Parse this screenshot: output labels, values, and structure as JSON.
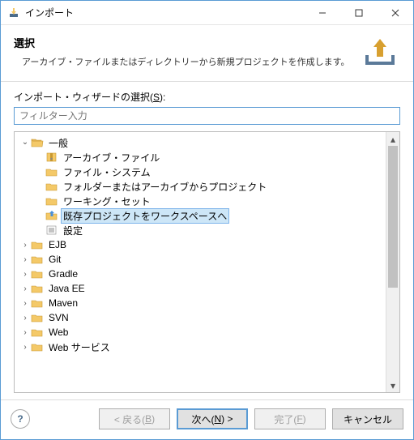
{
  "window": {
    "title": "インポート"
  },
  "banner": {
    "title": "選択",
    "description": "アーカイブ・ファイルまたはディレクトリーから新規プロジェクトを作成します。"
  },
  "form": {
    "select_label_prefix": "インポート・ウィザードの選択(",
    "select_mnemonic": "S",
    "select_label_suffix": "):",
    "filter_placeholder": "フィルター入力"
  },
  "tree": [
    {
      "label": "一般",
      "depth": 0,
      "expandable": true,
      "expanded": true,
      "icon": "folder-open",
      "selected": false
    },
    {
      "label": "アーカイブ・ファイル",
      "depth": 1,
      "expandable": false,
      "icon": "archive",
      "selected": false
    },
    {
      "label": "ファイル・システム",
      "depth": 1,
      "expandable": false,
      "icon": "folder",
      "selected": false
    },
    {
      "label": "フォルダーまたはアーカイブからプロジェクト",
      "depth": 1,
      "expandable": false,
      "icon": "folder",
      "selected": false
    },
    {
      "label": "ワーキング・セット",
      "depth": 1,
      "expandable": false,
      "icon": "folder",
      "selected": false
    },
    {
      "label": "既存プロジェクトをワークスペースへ",
      "depth": 1,
      "expandable": false,
      "icon": "import",
      "selected": true
    },
    {
      "label": "設定",
      "depth": 1,
      "expandable": false,
      "icon": "prefs",
      "selected": false
    },
    {
      "label": "EJB",
      "depth": 0,
      "expandable": true,
      "expanded": false,
      "icon": "folder",
      "selected": false
    },
    {
      "label": "Git",
      "depth": 0,
      "expandable": true,
      "expanded": false,
      "icon": "folder",
      "selected": false
    },
    {
      "label": "Gradle",
      "depth": 0,
      "expandable": true,
      "expanded": false,
      "icon": "folder",
      "selected": false
    },
    {
      "label": "Java EE",
      "depth": 0,
      "expandable": true,
      "expanded": false,
      "icon": "folder",
      "selected": false
    },
    {
      "label": "Maven",
      "depth": 0,
      "expandable": true,
      "expanded": false,
      "icon": "folder",
      "selected": false
    },
    {
      "label": "SVN",
      "depth": 0,
      "expandable": true,
      "expanded": false,
      "icon": "folder",
      "selected": false
    },
    {
      "label": "Web",
      "depth": 0,
      "expandable": true,
      "expanded": false,
      "icon": "folder",
      "selected": false
    },
    {
      "label": "Web サービス",
      "depth": 0,
      "expandable": true,
      "expanded": false,
      "icon": "folder",
      "selected": false
    }
  ],
  "buttons": {
    "back": {
      "prefix": "< 戻る(",
      "mnemonic": "B",
      "suffix": ")",
      "enabled": false
    },
    "next": {
      "prefix": "次へ(",
      "mnemonic": "N",
      "suffix": ") >",
      "enabled": true,
      "default": true
    },
    "finish": {
      "prefix": "完了(",
      "mnemonic": "F",
      "suffix": ")",
      "enabled": false
    },
    "cancel": {
      "label": "キャンセル",
      "enabled": true
    }
  }
}
